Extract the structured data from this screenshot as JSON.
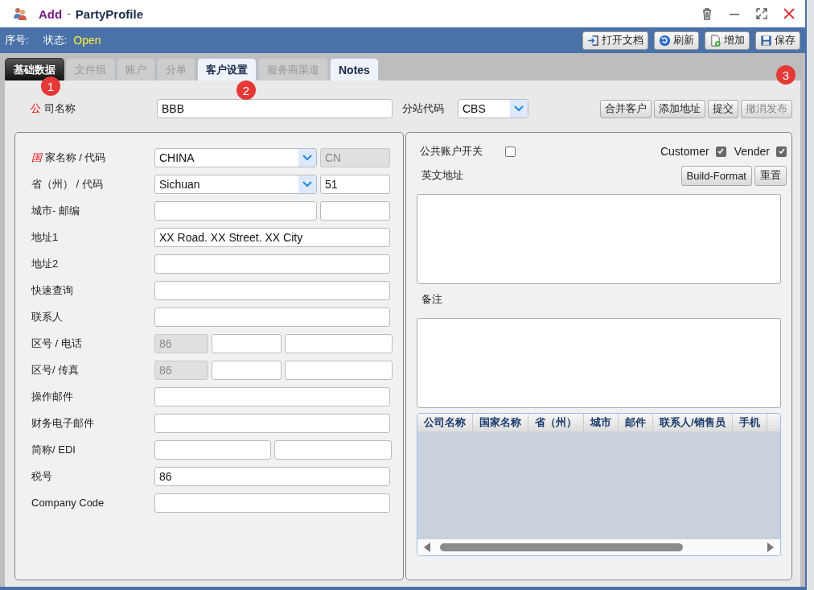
{
  "window": {
    "title_prefix": "Add",
    "title_sep": "-",
    "title": "PartyProfile"
  },
  "toolbar": {
    "serial_label": "序号:",
    "status_label": "状态:",
    "status": "Open",
    "buttons": [
      {
        "label": "打开文档",
        "kind": "open"
      },
      {
        "label": "刷新",
        "kind": "refresh"
      },
      {
        "label": "增加",
        "kind": "add"
      },
      {
        "label": "保存",
        "kind": "save"
      }
    ]
  },
  "tabs": [
    {
      "label": "基础数据",
      "selected": true,
      "disabled": false
    },
    {
      "label": "文件组",
      "selected": false,
      "disabled": true
    },
    {
      "label": "账户",
      "selected": false,
      "disabled": true
    },
    {
      "label": "分单",
      "selected": false,
      "disabled": true
    },
    {
      "label": "客户设置",
      "selected": false,
      "disabled": false
    },
    {
      "label": "服务商渠道",
      "selected": false,
      "disabled": true
    },
    {
      "label": "Notes",
      "selected": false,
      "disabled": false
    }
  ],
  "annotations": [
    "1",
    "2",
    "3"
  ],
  "company": {
    "flag": "公",
    "label": "司名称",
    "value": "BBB",
    "branch_label": "分站代码",
    "branch_value": "CBS",
    "buttons": [
      {
        "label": "合并客户",
        "disabled": false
      },
      {
        "label": "添加地址",
        "disabled": false
      },
      {
        "label": "提交",
        "disabled": false
      },
      {
        "label": "撤消发布",
        "disabled": true
      }
    ]
  },
  "address_rows": [
    {
      "flag": "国",
      "label": "家名称 / 代码",
      "kind": "select_code",
      "inputs": [
        {
          "kind": "select",
          "value": "CHINA"
        },
        {
          "kind": "text",
          "value": "CN",
          "disabled": true
        }
      ]
    },
    {
      "label": "省（州） / 代码",
      "kind": "select_code",
      "inputs": [
        {
          "kind": "select",
          "value": "Sichuan"
        },
        {
          "kind": "text",
          "value": "51",
          "disabled": false
        }
      ]
    },
    {
      "label": "城市- 邮编",
      "kind": "select_code",
      "inputs": [
        {
          "kind": "text",
          "disabled": false
        },
        {
          "kind": "text",
          "disabled": false
        }
      ]
    },
    {
      "label": "地址1",
      "kind": "single",
      "inputs": [
        {
          "kind": "text",
          "value": "XX Road. XX Street. XX City",
          "disabled": false
        }
      ]
    },
    {
      "label": "地址2",
      "kind": "single",
      "inputs": [
        {
          "kind": "text",
          "disabled": false
        }
      ]
    },
    {
      "label": "快速查询",
      "kind": "single",
      "inputs": [
        {
          "kind": "text",
          "disabled": false
        }
      ]
    },
    {
      "label": "联系人",
      "kind": "single",
      "inputs": [
        {
          "kind": "text",
          "disabled": false
        }
      ]
    },
    {
      "label": "区号 /  电话",
      "kind": "triple",
      "inputs": [
        {
          "kind": "text",
          "value": "86",
          "disabled": true
        },
        {
          "kind": "text",
          "disabled": false
        },
        {
          "kind": "text",
          "disabled": false
        }
      ]
    },
    {
      "label": "区号/  传真",
      "kind": "triple",
      "inputs": [
        {
          "kind": "text",
          "value": "86",
          "disabled": true
        },
        {
          "kind": "text",
          "disabled": false
        },
        {
          "kind": "text",
          "disabled": false
        }
      ]
    },
    {
      "label": "操作邮件",
      "kind": "single",
      "inputs": [
        {
          "kind": "text",
          "disabled": false
        }
      ]
    },
    {
      "label": "财务电子邮件",
      "kind": "single",
      "inputs": [
        {
          "kind": "text",
          "disabled": false
        }
      ]
    },
    {
      "label": "简称/ EDI",
      "kind": "split",
      "inputs": [
        {
          "kind": "text",
          "disabled": false
        },
        {
          "kind": "text",
          "disabled": false
        }
      ]
    },
    {
      "label": "税号",
      "kind": "single",
      "inputs": [
        {
          "kind": "text",
          "value": "86",
          "disabled": false
        }
      ]
    },
    {
      "label": "Company Code",
      "kind": "single",
      "inputs": [
        {
          "kind": "text",
          "disabled": false
        }
      ]
    }
  ],
  "right": {
    "public_switch": {
      "label": "公共账户开关",
      "checked": false
    },
    "roles": [
      {
        "label": "Customer",
        "checked": true
      },
      {
        "label": "Vender",
        "checked": true
      }
    ],
    "english_address_label": "英文地址",
    "buttons": [
      "Build-Format",
      "重置"
    ],
    "notes_label": "备注",
    "table": {
      "columns": [
        "公司名称",
        "国家名称",
        "省（州）",
        "城市",
        "邮件",
        "联系人/销售员",
        "手机"
      ]
    }
  }
}
